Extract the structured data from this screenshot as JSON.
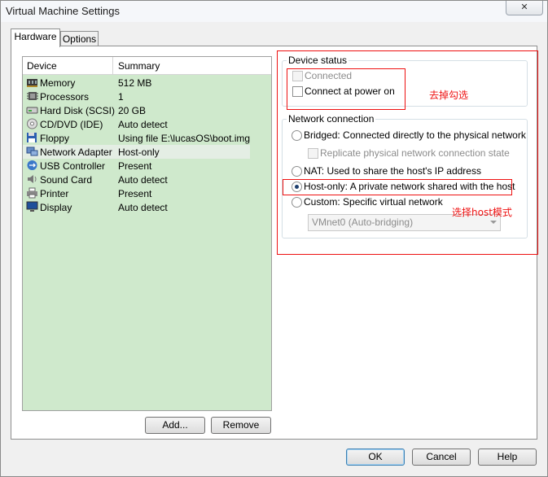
{
  "window": {
    "title": "Virtual Machine Settings",
    "close_glyph": "✕"
  },
  "tabs": [
    {
      "label": "Hardware"
    },
    {
      "label": "Options"
    }
  ],
  "device_list": {
    "columns": {
      "device": "Device",
      "summary": "Summary"
    },
    "rows": [
      {
        "device": "Memory",
        "summary": "512 MB",
        "icon": "memory-icon"
      },
      {
        "device": "Processors",
        "summary": "1",
        "icon": "processor-icon"
      },
      {
        "device": "Hard Disk (SCSI)",
        "summary": "20 GB",
        "icon": "hard-disk-icon"
      },
      {
        "device": "CD/DVD (IDE)",
        "summary": "Auto detect",
        "icon": "cd-dvd-icon"
      },
      {
        "device": "Floppy",
        "summary": "Using file E:\\lucasOS\\boot.img",
        "icon": "floppy-icon"
      },
      {
        "device": "Network Adapter",
        "summary": "Host-only",
        "icon": "network-adapter-icon",
        "selected": true
      },
      {
        "device": "USB Controller",
        "summary": "Present",
        "icon": "usb-icon"
      },
      {
        "device": "Sound Card",
        "summary": "Auto detect",
        "icon": "speaker-icon"
      },
      {
        "device": "Printer",
        "summary": "Present",
        "icon": "printer-icon"
      },
      {
        "device": "Display",
        "summary": "Auto detect",
        "icon": "monitor-icon"
      }
    ],
    "add_label": "Add...",
    "remove_label": "Remove"
  },
  "device_status": {
    "title": "Device status",
    "connected": {
      "label": "Connected",
      "checked": false,
      "enabled": false
    },
    "connect_at_power_on": {
      "label": "Connect at power on",
      "checked": false,
      "enabled": true
    }
  },
  "network_connection": {
    "title": "Network connection",
    "options": {
      "bridged": {
        "label": "Bridged: Connected directly to the physical network",
        "selected": false
      },
      "replicate": {
        "label": "Replicate physical network connection state",
        "checked": false,
        "enabled": false
      },
      "nat": {
        "label": "NAT: Used to share the host's IP address",
        "selected": false
      },
      "host_only": {
        "label": "Host-only: A private network shared with the host",
        "selected": true
      },
      "custom": {
        "label": "Custom: Specific virtual network",
        "selected": false
      }
    },
    "vmnet_select": {
      "value": "VMnet0 (Auto-bridging)",
      "enabled": false
    }
  },
  "annotations": {
    "uncheck_note": "去掉勾选",
    "host_mode_note": "选择host模式",
    "color": "#ee1111"
  },
  "footer": {
    "ok_label": "OK",
    "cancel_label": "Cancel",
    "help_label": "Help"
  },
  "colors": {
    "device_list_bg": "#cfe9cc",
    "selected_row": "#e4eee4",
    "default_button_border": "#3c7fb1"
  }
}
